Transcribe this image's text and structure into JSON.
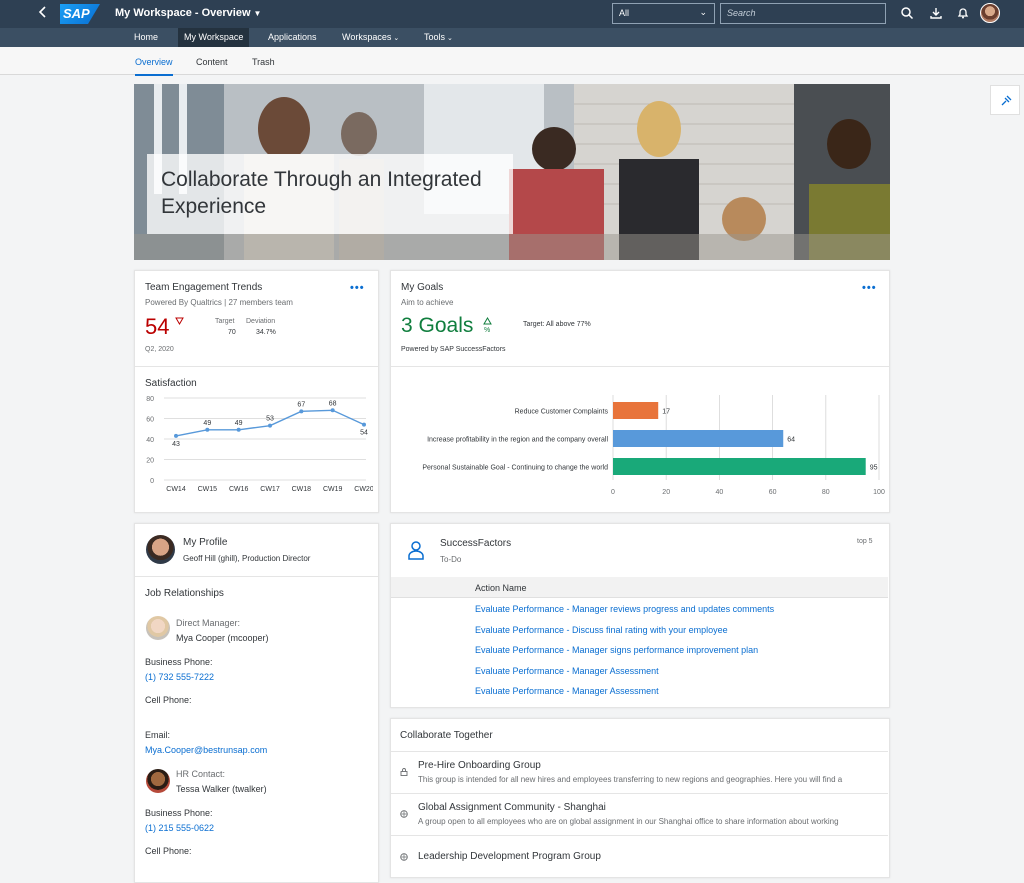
{
  "shell": {
    "title": "My Workspace - Overview",
    "logo": "SAP",
    "scope": "All",
    "search_placeholder": "Search",
    "icons": [
      "back-icon",
      "search-icon",
      "download-icon",
      "notification-icon",
      "avatar"
    ]
  },
  "nav": {
    "items": [
      {
        "label": "Home"
      },
      {
        "label": "My Workspace",
        "active": true
      },
      {
        "label": "Applications"
      },
      {
        "label": "Workspaces",
        "dropdown": true
      },
      {
        "label": "Tools",
        "dropdown": true
      }
    ]
  },
  "tabs": [
    {
      "label": "Overview",
      "active": true
    },
    {
      "label": "Content"
    },
    {
      "label": "Trash"
    }
  ],
  "hero": {
    "title": "Collaborate Through an Integrated Experience"
  },
  "engagement": {
    "title": "Team Engagement Trends",
    "subtitle": "Powered By Qualtrics | 27 members team",
    "kpi": "54",
    "target_label": "Target",
    "target_value": "70",
    "deviation_label": "Deviation",
    "deviation_value": "34.7%",
    "period": "Q2, 2020",
    "satisfaction_title": "Satisfaction"
  },
  "goals": {
    "title": "My Goals",
    "subtitle": "Aim to achieve",
    "kpi": "3 Goals",
    "kpi_unit": "%",
    "target_text": "Target: All above 77%",
    "powered": "Powered by SAP SuccessFactors"
  },
  "chart_data": [
    {
      "type": "line",
      "title": "Satisfaction",
      "categories": [
        "CW14",
        "CW15",
        "CW16",
        "CW17",
        "CW18",
        "CW19",
        "CW20"
      ],
      "values": [
        43,
        49,
        49,
        53,
        67,
        68,
        54
      ],
      "yticks": [
        0,
        20,
        40,
        60,
        80
      ],
      "ylim": [
        0,
        80
      ],
      "color": "#5899da"
    },
    {
      "type": "bar",
      "orientation": "horizontal",
      "categories": [
        "Reduce Customer Complaints",
        "Increase profitability in the region and the company overall",
        "Personal Sustainable Goal - Continuing to change the world"
      ],
      "values": [
        17,
        64,
        95
      ],
      "colors": [
        "#e8743b",
        "#5899da",
        "#19a979"
      ],
      "xticks": [
        0,
        20,
        40,
        60,
        80,
        100
      ],
      "xlim": [
        0,
        100
      ]
    }
  ],
  "profile": {
    "title": "My Profile",
    "subtitle": "Geoff Hill (ghill), Production Director",
    "section": "Job Relationships",
    "manager_label": "Direct Manager:",
    "manager_name": "Mya Cooper (mcooper)",
    "business_phone_label": "Business Phone:",
    "manager_phone": "(1) 732 555-7222",
    "cell_phone_label": "Cell Phone:",
    "email_label": "Email:",
    "manager_email": "Mya.Cooper@bestrunsap.com",
    "hr_label": "HR Contact:",
    "hr_name": "Tessa Walker (twalker)",
    "hr_phone": "(1) 215 555-0622"
  },
  "todo": {
    "title": "SuccessFactors",
    "subtitle": "To-Do",
    "badge": "top 5",
    "column": "Action Name",
    "rows": [
      "Evaluate Performance - Manager reviews progress and updates comments",
      "Evaluate Performance - Discuss final rating with your employee",
      "Evaluate Performance - Manager signs performance improvement plan",
      "Evaluate Performance - Manager Assessment",
      "Evaluate Performance - Manager Assessment"
    ]
  },
  "collaborate": {
    "title": "Collaborate Together",
    "groups": [
      {
        "name": "Pre-Hire Onboarding Group",
        "desc": "This group is intended for all new hires and employees transferring to new regions and geographies. Here you will find a"
      },
      {
        "name": "Global Assignment Community - Shanghai",
        "desc": "A group open to all employees who are on global assignment in our Shanghai office to share information about working"
      },
      {
        "name": "Leadership Development Program Group",
        "desc": ""
      }
    ]
  }
}
